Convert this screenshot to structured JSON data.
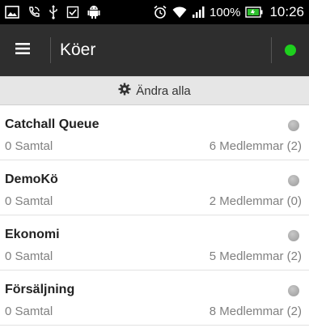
{
  "status_bar": {
    "battery_percent": "100%",
    "time": "10:26",
    "icons_left": [
      "screenshot-icon",
      "phone-icon",
      "usb-icon",
      "checkbox-icon",
      "android-icon"
    ],
    "icons_right": [
      "alarm-icon",
      "wifi-icon",
      "signal-icon",
      "battery-icon"
    ]
  },
  "app_bar": {
    "title": "Köer",
    "connection_status_color": "#1ed01e"
  },
  "change_all": {
    "label": "Ändra alla",
    "icon": "gear-icon"
  },
  "queues": [
    {
      "name": "Catchall Queue",
      "calls": "0 Samtal",
      "members": "6 Medlemmar (2)"
    },
    {
      "name": "DemoKö",
      "calls": "0 Samtal",
      "members": "2 Medlemmar (0)"
    },
    {
      "name": "Ekonomi",
      "calls": "0 Samtal",
      "members": "5 Medlemmar (2)"
    },
    {
      "name": "Försäljning",
      "calls": "0 Samtal",
      "members": "8 Medlemmar (2)"
    }
  ]
}
